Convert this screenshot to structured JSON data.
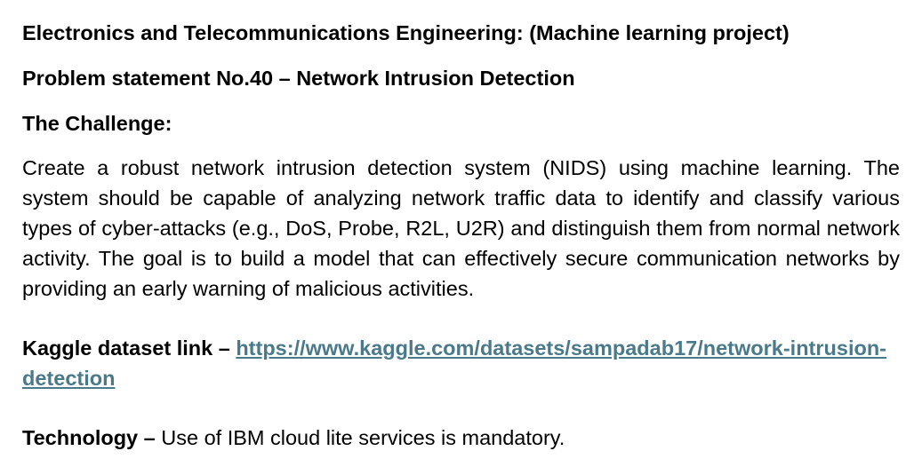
{
  "document": {
    "title": "Electronics and Telecommunications Engineering: (Machine learning project)",
    "problem_statement": "Problem statement No.40 – Network Intrusion Detection",
    "challenge_heading": "The Challenge:",
    "challenge_text": "Create a robust network intrusion detection system (NIDS) using machine learning. The system should be capable of analyzing network traffic data to identify and classify various types of cyber-attacks (e.g., DoS, Probe, R2L, U2R) and distinguish them from normal network activity. The goal is to build a model that can effectively secure communication networks by providing an early warning of malicious activities.",
    "dataset_label": "Kaggle dataset link – ",
    "dataset_link": "https://www.kaggle.com/datasets/sampadab17/network-intrusion-detection",
    "technology_label": "Technology – ",
    "technology_text": "Use of IBM cloud lite services is mandatory."
  },
  "colors": {
    "link": "#4a7a8a",
    "text": "#000000",
    "background": "#ffffff"
  }
}
